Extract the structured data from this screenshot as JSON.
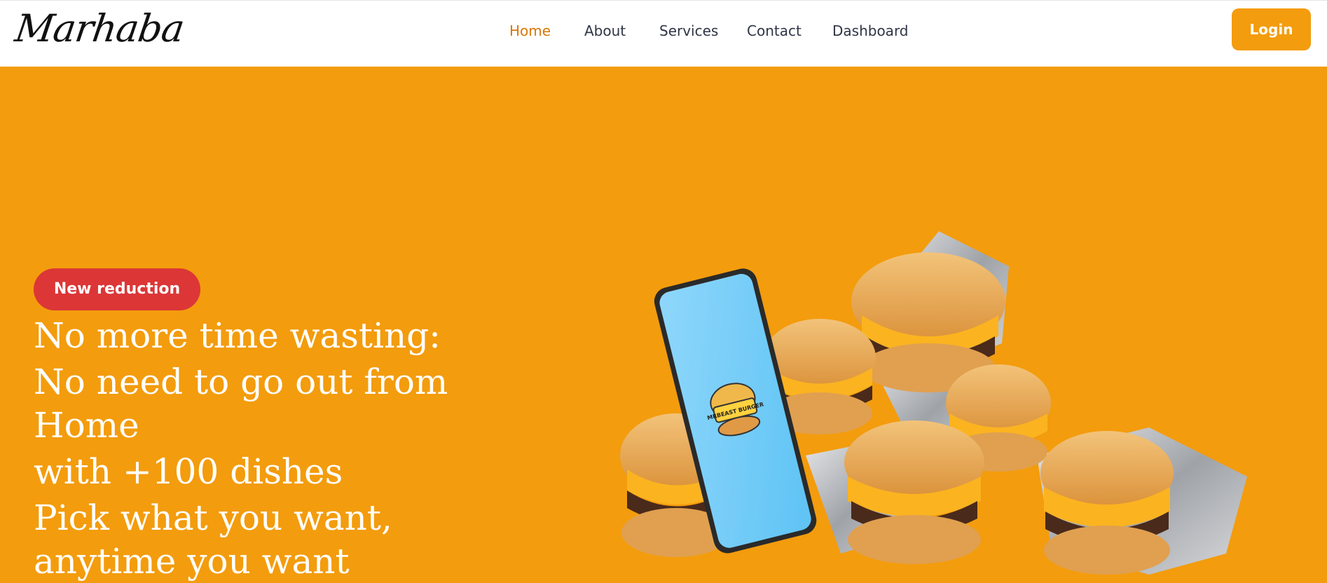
{
  "brand": {
    "logo_text": "Marhaba"
  },
  "nav": {
    "items": [
      {
        "label": "Home",
        "active": true
      },
      {
        "label": "About",
        "active": false
      },
      {
        "label": "Services",
        "active": false
      },
      {
        "label": "Contact",
        "active": false
      },
      {
        "label": "Dashboard",
        "active": false
      }
    ],
    "login_label": "Login"
  },
  "hero": {
    "badge": "New reduction",
    "lines": [
      "No more time wasting:",
      "No need to go out from",
      "Home",
      "with +100 dishes",
      "Pick what you want,",
      "anytime you want"
    ],
    "phone_logo_text": "MRBEAST BURGER"
  },
  "colors": {
    "accent": "#f39c0d",
    "active_link": "#d97706",
    "badge": "#dc3637",
    "nav_text": "#2f3545"
  }
}
